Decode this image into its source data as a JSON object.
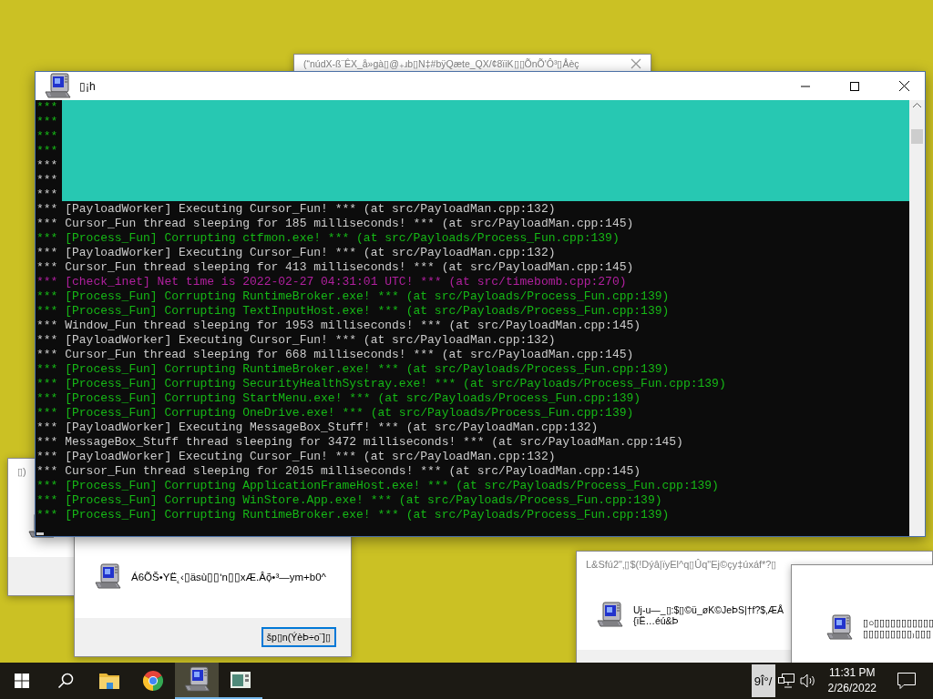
{
  "dialogs": [
    {
      "kind": "title_only",
      "title": "(“núdX-ß¨ÊX_å»gà▯@₊ɹb▯N‡#bÿQæte_QX/¢8ïiK▯▯ÕnÕ'Ô³▯Åèç"
    },
    {
      "kind": "title_only",
      "title": "▯)"
    },
    {
      "kind": "message_button",
      "message": "Á6ÕŠ•YË˛‹▯äsù▯▯ʹn▯▯xÆ.Âõ̦•³—ym+b0^",
      "button": "šp▯n(ÝèÞ÷o¨]▯"
    },
    {
      "kind": "titled_message",
      "title": "L&Sfú2\"‚▯$(!Dýâ|ïyEl^q▯Ûq\"Ej©çy‡úxáf*?▯",
      "lines": [
        "Uj-u—_▯:$▯©ü_øK©JeÞS|†f?$‚ÆÅ",
        "{ïË…éú&Þ"
      ]
    },
    {
      "kind": "message",
      "lines": [
        "▯○▯▯▯▯▯▯▯▯▯▯▯",
        "▯▯▯▯▯▯▯▯▯₎▯▯▯"
      ]
    }
  ],
  "console": {
    "title": "▯¡h",
    "lines": [
      {
        "kind": "process",
        "text": "***"
      },
      {
        "kind": "process",
        "text": "***"
      },
      {
        "kind": "process",
        "text": "***"
      },
      {
        "kind": "process",
        "text": "***"
      },
      {
        "kind": "info",
        "text": "***"
      },
      {
        "kind": "info",
        "text": "***"
      },
      {
        "kind": "info",
        "text": "***"
      },
      {
        "kind": "info",
        "text": "*** [PayloadWorker] Executing Cursor_Fun! *** (at src/PayloadMan.cpp:132)"
      },
      {
        "kind": "info",
        "text": "*** Cursor_Fun thread sleeping for 185 milliseconds! *** (at src/PayloadMan.cpp:145)"
      },
      {
        "kind": "process",
        "text": "*** [Process_Fun] Corrupting ctfmon.exe! *** (at src/Payloads/Process_Fun.cpp:139)"
      },
      {
        "kind": "info",
        "text": "*** [PayloadWorker] Executing Cursor_Fun! *** (at src/PayloadMan.cpp:132)"
      },
      {
        "kind": "info",
        "text": "*** Cursor_Fun thread sleeping for 413 milliseconds! *** (at src/PayloadMan.cpp:145)"
      },
      {
        "kind": "inet",
        "text": "*** [check_inet] Net time is 2022-02-27 04:31:01 UTC! *** (at src/timebomb.cpp:270)"
      },
      {
        "kind": "process",
        "text": "*** [Process_Fun] Corrupting RuntimeBroker.exe! *** (at src/Payloads/Process_Fun.cpp:139)"
      },
      {
        "kind": "process",
        "text": "*** [Process_Fun] Corrupting TextInputHost.exe! *** (at src/Payloads/Process_Fun.cpp:139)"
      },
      {
        "kind": "info",
        "text": "*** Window_Fun thread sleeping for 1953 milliseconds! *** (at src/PayloadMan.cpp:145)"
      },
      {
        "kind": "info",
        "text": "*** [PayloadWorker] Executing Cursor_Fun! *** (at src/PayloadMan.cpp:132)"
      },
      {
        "kind": "info",
        "text": "*** Cursor_Fun thread sleeping for 668 milliseconds! *** (at src/PayloadMan.cpp:145)"
      },
      {
        "kind": "process",
        "text": "*** [Process_Fun] Corrupting RuntimeBroker.exe! *** (at src/Payloads/Process_Fun.cpp:139)"
      },
      {
        "kind": "process",
        "text": "*** [Process_Fun] Corrupting SecurityHealthSystray.exe! *** (at src/Payloads/Process_Fun.cpp:139)"
      },
      {
        "kind": "process",
        "text": "*** [Process_Fun] Corrupting StartMenu.exe! *** (at src/Payloads/Process_Fun.cpp:139)"
      },
      {
        "kind": "process",
        "text": "*** [Process_Fun] Corrupting OneDrive.exe! *** (at src/Payloads/Process_Fun.cpp:139)"
      },
      {
        "kind": "info",
        "text": "*** [PayloadWorker] Executing MessageBox_Stuff! *** (at src/PayloadMan.cpp:132)"
      },
      {
        "kind": "info",
        "text": "*** MessageBox_Stuff thread sleeping for 3472 milliseconds! *** (at src/PayloadMan.cpp:145)"
      },
      {
        "kind": "info",
        "text": "*** [PayloadWorker] Executing Cursor_Fun! *** (at src/PayloadMan.cpp:132)"
      },
      {
        "kind": "info",
        "text": "*** Cursor_Fun thread sleeping for 2015 milliseconds! *** (at src/PayloadMan.cpp:145)"
      },
      {
        "kind": "process",
        "text": "*** [Process_Fun] Corrupting ApplicationFrameHost.exe! *** (at src/Payloads/Process_Fun.cpp:139)"
      },
      {
        "kind": "process",
        "text": "*** [Process_Fun] Corrupting WinStore.App.exe! *** (at src/Payloads/Process_Fun.cpp:139)"
      },
      {
        "kind": "process",
        "text": "*** [Process_Fun] Corrupting RuntimeBroker.exe! *** (at src/Payloads/Process_Fun.cpp:139)"
      }
    ]
  },
  "taskbar": {
    "apps": [
      {
        "kind": "start",
        "selected": false,
        "running": false
      },
      {
        "kind": "search",
        "selected": false,
        "running": false
      },
      {
        "kind": "explorer",
        "selected": false,
        "running": false
      },
      {
        "kind": "chrome",
        "selected": false,
        "running": false
      },
      {
        "kind": "computer",
        "selected": true,
        "running": true
      },
      {
        "kind": "window",
        "selected": false,
        "running": true
      }
    ],
    "input_indicator": "9Î°/",
    "time": "11:31 PM",
    "date": "2/26/2022"
  }
}
